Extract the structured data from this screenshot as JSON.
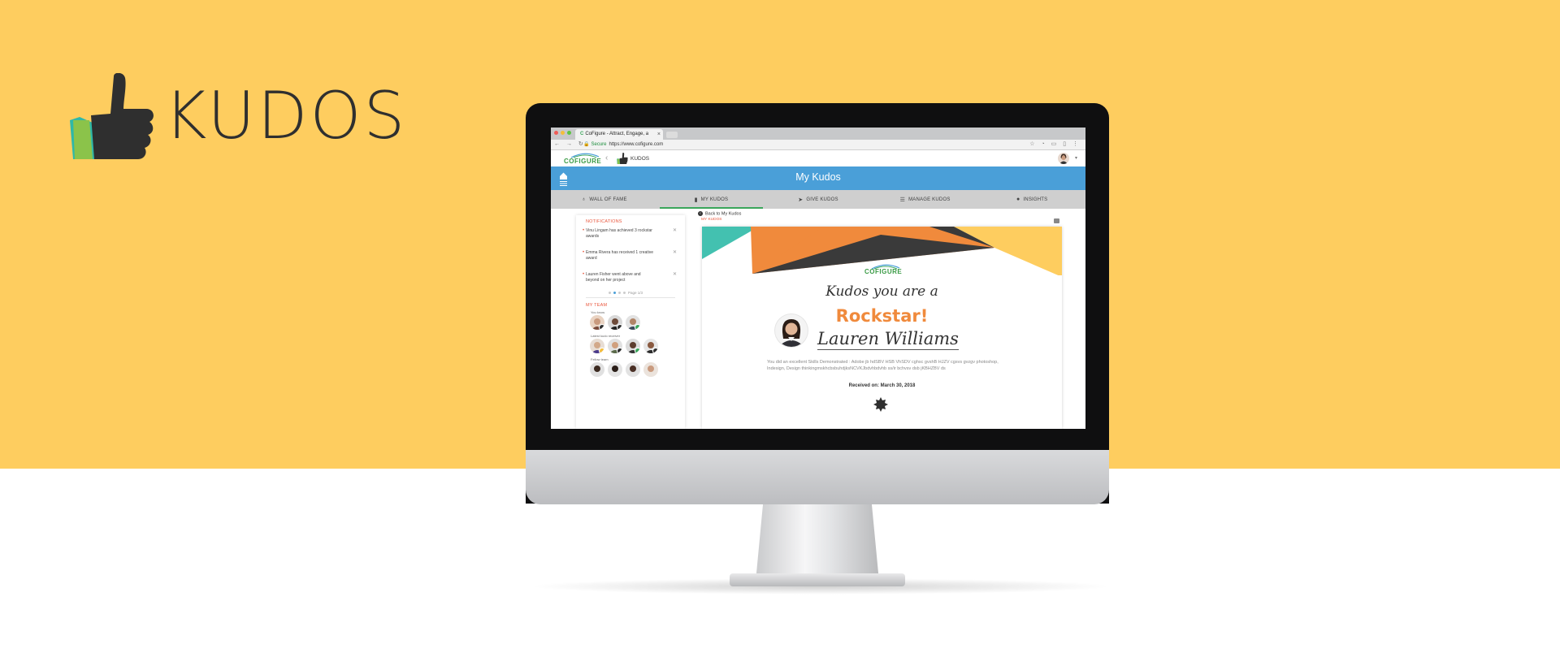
{
  "colors": {
    "background": "#fecd5f",
    "banner": "#4a9fd8",
    "accent_green": "#3aa65b",
    "accent_orange": "#f08a3c",
    "notification_red": "#e9563c"
  },
  "brand": {
    "title": "KUDOS",
    "icon": "thumbs-up-icon"
  },
  "browser": {
    "tab_title": "CoFigure - Attract, Engage, a",
    "tab_close": "×",
    "secure_label": "Secure",
    "url": "https://www.cofigure.com"
  },
  "app": {
    "logo": "COFIGURE",
    "module_label": "KUDOS",
    "banner_title": "My Kudos",
    "nav": [
      {
        "label": "WALL OF FAME",
        "icon": "trophy-icon"
      },
      {
        "label": "MY KUDOS",
        "icon": "badge-icon",
        "active": true
      },
      {
        "label": "GIVE KUDOS",
        "icon": "send-icon"
      },
      {
        "label": "MANAGE KUDOS",
        "icon": "database-icon"
      },
      {
        "label": "INSIGHTS",
        "icon": "lightbulb-icon"
      }
    ]
  },
  "notifications": {
    "title": "NOTIFICATIONS",
    "items": [
      {
        "text": "Vinu Lingam has achieved 3 rockstar awards"
      },
      {
        "text": "Emma Rivera has received 1 creative award"
      },
      {
        "text": "Lauren Fisher went above and beyond on her project"
      }
    ],
    "pager": "Page 1/3"
  },
  "team": {
    "title": "MY TEAM",
    "groups": [
      {
        "label": "You know"
      },
      {
        "label": "Latest kudo receiver"
      },
      {
        "label": "Fellow team"
      }
    ]
  },
  "kudos_view": {
    "back_link": "Back to My Kudos",
    "breadcrumb": "MY KUDOS"
  },
  "certificate": {
    "logo": "COFIGURE",
    "heading": "Kudos you are a",
    "award": "Rockstar!",
    "recipient": "Lauren Williams",
    "description": "You did an excellent Skills Demonstrated : Adobe jb hdSBV HSB VhSDV cghsc gvshB HJZV cgsvs gvzgv photoshop, Indesign, Design thinkingmskhcbsbuhdjksNCVKJbdvhbdvhb ss/ir bchvsv dsb jKBHZBV ds",
    "received_label": "Received on:",
    "received_date": "March 30, 2018"
  }
}
